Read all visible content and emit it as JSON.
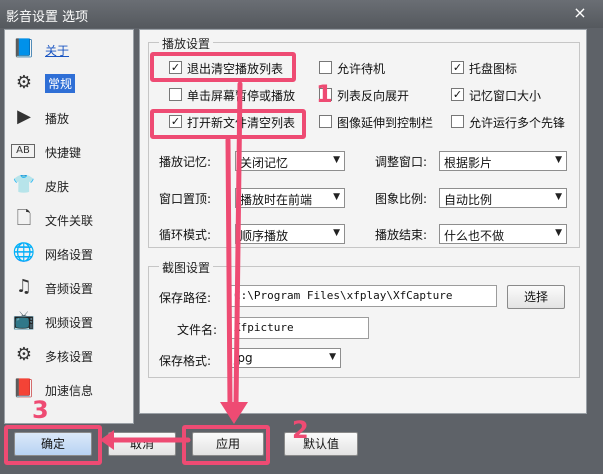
{
  "window": {
    "title": "影音设置 选项",
    "close_label": "×"
  },
  "sidebar": {
    "items": [
      {
        "label": "关于",
        "icon": "info-icon"
      },
      {
        "label": "常规",
        "icon": "gear-icon"
      },
      {
        "label": "播放",
        "icon": "play-icon"
      },
      {
        "label": "快捷键",
        "icon": "keyboard-icon"
      },
      {
        "label": "皮肤",
        "icon": "shirt-icon"
      },
      {
        "label": "文件关联",
        "icon": "file-icon"
      },
      {
        "label": "网络设置",
        "icon": "globe-icon"
      },
      {
        "label": "音频设置",
        "icon": "audio-icon"
      },
      {
        "label": "视频设置",
        "icon": "tv-icon"
      },
      {
        "label": "多核设置",
        "icon": "cpu-icon"
      },
      {
        "label": "加速信息",
        "icon": "speed-icon"
      }
    ]
  },
  "play_settings": {
    "group_title": "播放设置",
    "checkboxes": [
      {
        "label": "退出清空播放列表",
        "checked": true
      },
      {
        "label": "允许待机",
        "checked": false
      },
      {
        "label": "托盘图标",
        "checked": true
      },
      {
        "label": "单击屏幕暂停或播放",
        "checked": false
      },
      {
        "label": "列表反向展开",
        "checked": false
      },
      {
        "label": "记忆窗口大小",
        "checked": true
      },
      {
        "label": "打开新文件清空列表",
        "checked": true
      },
      {
        "label": "图像延伸到控制栏",
        "checked": false
      },
      {
        "label": "允许运行多个先锋",
        "checked": false
      }
    ],
    "check_mark": "✓",
    "fields": [
      {
        "label": "播放记忆:",
        "value": "关闭记忆"
      },
      {
        "label": "调整窗口:",
        "value": "根据影片"
      },
      {
        "label": "窗口置顶:",
        "value": "播放时在前端"
      },
      {
        "label": "图象比例:",
        "value": "自动比例"
      },
      {
        "label": "循环模式:",
        "value": "顺序播放"
      },
      {
        "label": "播放结束:",
        "value": "什么也不做"
      }
    ],
    "dropdown_arrow": "▼"
  },
  "capture_settings": {
    "group_title": "截图设置",
    "save_path_label": "保存路径:",
    "save_path_value": "C:\\Program Files\\xfplay\\XfCapture",
    "browse_label": "选择",
    "file_name_label": "文件名:",
    "file_name_value": "Xfpicture",
    "format_label": "保存格式:",
    "format_value": "jpg"
  },
  "buttons": {
    "ok": "确定",
    "cancel": "取消",
    "apply": "应用",
    "default": "默认值"
  },
  "annotations": {
    "n1": "1",
    "n2": "2",
    "n3": "3"
  },
  "colors": {
    "highlight": "#ee4b73",
    "selected": "#2f6fd6"
  }
}
